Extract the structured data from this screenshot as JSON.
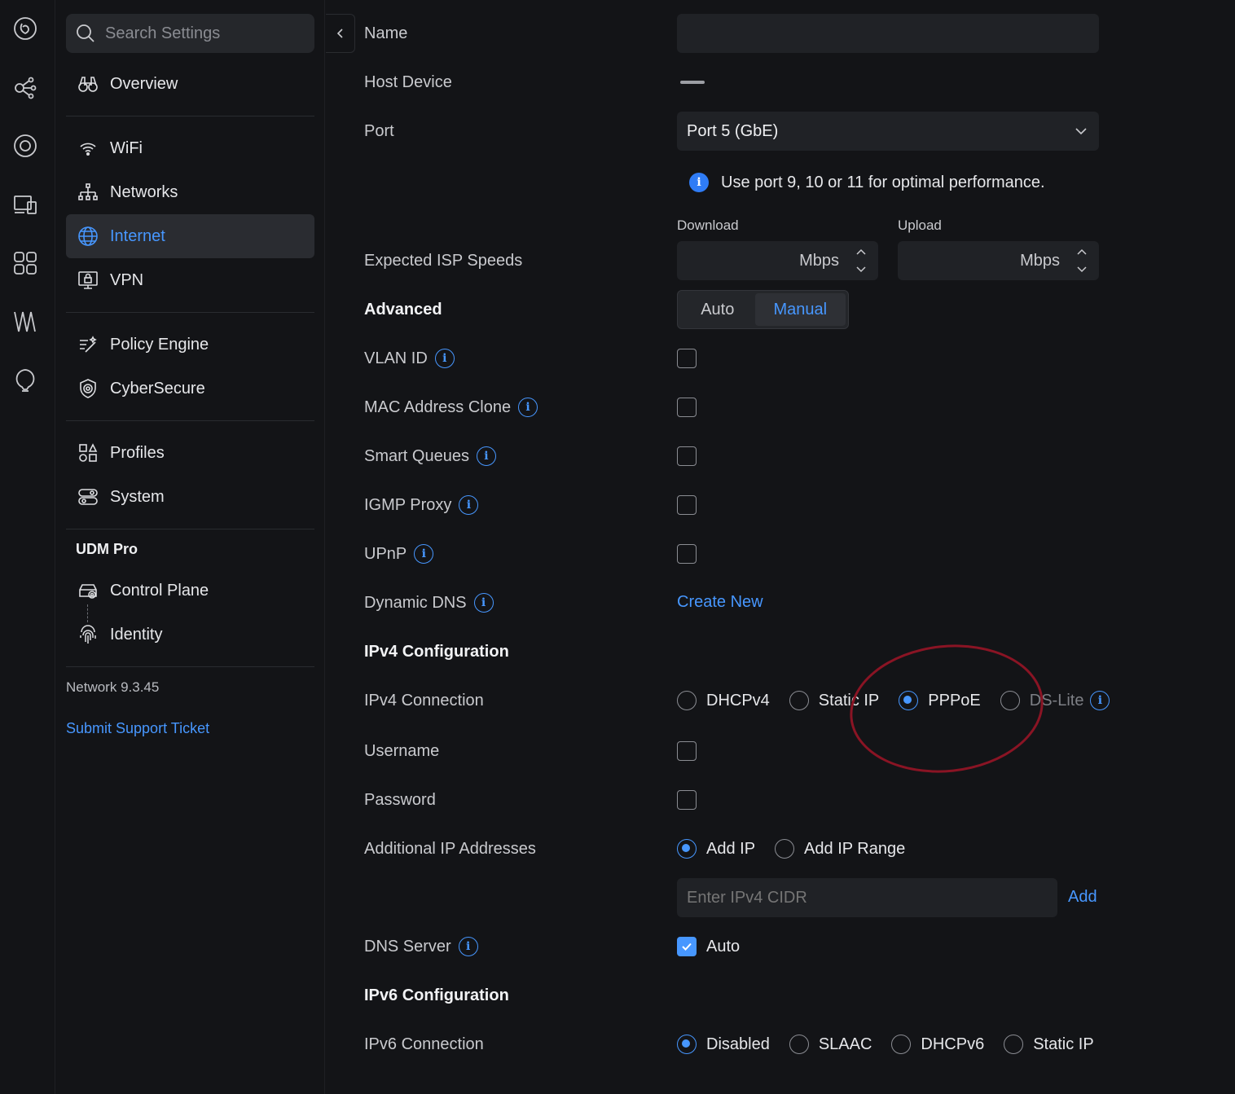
{
  "colors": {
    "accent": "#4797ff",
    "bg": "#131417",
    "field": "#202226",
    "annotation": "#8a1424"
  },
  "rail": [
    "unifi-logo-icon",
    "topology-icon",
    "target-icon",
    "devices-icon",
    "clients-icon",
    "insights-icon",
    "alerts-icon"
  ],
  "sidebar": {
    "search_placeholder": "Search Settings",
    "overview": "Overview",
    "wifi": "WiFi",
    "networks": "Networks",
    "internet": "Internet",
    "vpn": "VPN",
    "policy_engine": "Policy Engine",
    "cybersecure": "CyberSecure",
    "profiles": "Profiles",
    "system": "System",
    "device_title": "UDM Pro",
    "control_plane": "Control Plane",
    "identity": "Identity",
    "version": "Network 9.3.45",
    "support": "Submit Support Ticket"
  },
  "form": {
    "name_label": "Name",
    "host_device_label": "Host Device",
    "port_label": "Port",
    "port_value": "Port 5 (GbE)",
    "port_hint": "Use port 9, 10 or 11 for optimal performance.",
    "download_label": "Download",
    "upload_label": "Upload",
    "isp_speeds_label": "Expected ISP Speeds",
    "mbps": "Mbps",
    "advanced_label": "Advanced",
    "auto": "Auto",
    "manual": "Manual",
    "vlan_label": "VLAN ID",
    "mac_clone_label": "MAC Address Clone",
    "smart_queues_label": "Smart Queues",
    "igmp_label": "IGMP Proxy",
    "upnp_label": "UPnP",
    "ddns_label": "Dynamic DNS",
    "create_new": "Create New",
    "ipv4_config": "IPv4 Configuration",
    "ipv4_connection_label": "IPv4 Connection",
    "ipv4_options": [
      "DHCPv4",
      "Static IP",
      "PPPoE",
      "DS-Lite"
    ],
    "ipv4_selected": "PPPoE",
    "username_label": "Username",
    "password_label": "Password",
    "additional_ip_label": "Additional IP Addresses",
    "add_ip": "Add IP",
    "add_ip_range": "Add IP Range",
    "cidr_placeholder": "Enter IPv4 CIDR",
    "add": "Add",
    "dns_label": "DNS Server",
    "dns_auto": "Auto",
    "ipv6_config": "IPv6 Configuration",
    "ipv6_connection_label": "IPv6 Connection",
    "ipv6_options": [
      "Disabled",
      "SLAAC",
      "DHCPv6",
      "Static IP"
    ],
    "ipv6_selected": "Disabled"
  }
}
